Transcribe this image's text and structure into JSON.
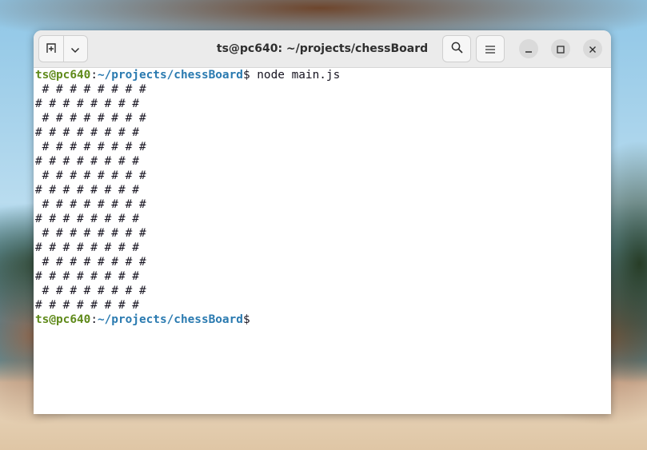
{
  "window": {
    "title": "ts@pc640: ~/projects/chessBoard"
  },
  "prompt": {
    "user": "ts@pc640",
    "colon": ":",
    "path": "~/projects/chessBoard",
    "dollar": "$"
  },
  "command": " node main.js",
  "output": [
    " # # # # # # # #",
    "# # # # # # # #",
    " # # # # # # # #",
    "# # # # # # # #",
    " # # # # # # # #",
    "# # # # # # # #",
    " # # # # # # # #",
    "# # # # # # # #",
    " # # # # # # # #",
    "# # # # # # # #",
    " # # # # # # # #",
    "# # # # # # # #",
    " # # # # # # # #",
    "# # # # # # # #",
    " # # # # # # # #",
    "# # # # # # # #"
  ],
  "icons": {
    "new_tab": "new-tab-icon",
    "dropdown": "chevron-down-icon",
    "search": "search-icon",
    "menu": "hamburger-menu-icon",
    "minimize": "minimize-icon",
    "maximize": "maximize-icon",
    "close": "close-icon"
  },
  "colors": {
    "prompt_user": "#5f8a1a",
    "prompt_path": "#2a7ab0",
    "terminal_bg": "#ffffff",
    "titlebar_bg": "#ebebeb"
  }
}
